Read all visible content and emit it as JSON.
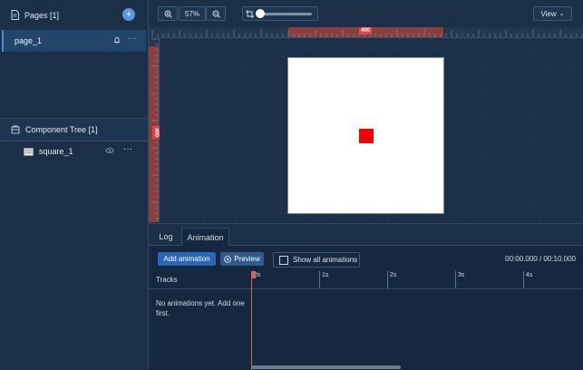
{
  "pages": {
    "title": "Pages [1]",
    "items": [
      {
        "label": "page_1"
      }
    ]
  },
  "component_tree": {
    "title": "Component Tree [1]",
    "items": [
      {
        "label": "square_1"
      }
    ]
  },
  "toolbar": {
    "zoom": "57%",
    "view_label": "View"
  },
  "canvas": {
    "width_label": "400",
    "height_label": "400"
  },
  "bottom": {
    "tabs": [
      {
        "label": "Log"
      },
      {
        "label": "Animation"
      }
    ],
    "add_animation": "Add animation",
    "preview": "Preview",
    "show_all": "Show all animations",
    "timecode": "00:00.000 / 00:10.000",
    "tracks_label": "Tracks",
    "empty_message": "No animations yet. Add one first.",
    "time_marks": [
      "0s",
      "1s",
      "2s",
      "3s",
      "4s"
    ]
  },
  "colors": {
    "accent": "#4d8bd6",
    "square": "#f40000",
    "highlight": "#e04848"
  }
}
